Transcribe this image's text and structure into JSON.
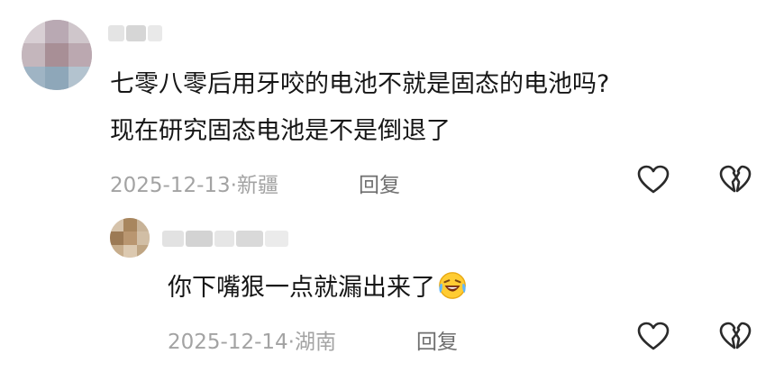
{
  "comments": [
    {
      "text_line1": "七零八零后用牙咬的电池不就是固态的电池吗?",
      "text_line2": "现在研究固态电池是不是倒退了",
      "date": "2025-12-13",
      "separator": "·",
      "location": "新疆",
      "reply_label": "回复"
    }
  ],
  "replies": [
    {
      "text": "你下嘴狠一点就漏出来了",
      "emoji_icon": "laughing-crying-face-icon",
      "date": "2025-12-14",
      "separator": "·",
      "location": "湖南",
      "reply_label": "回复"
    }
  ],
  "icons": {
    "like": "heart-outline-icon",
    "dislike": "broken-heart-icon"
  },
  "colors": {
    "text": "#161616",
    "meta": "#a3a3a3",
    "reply": "#6f6f6f",
    "icon": "#2a2a2a"
  }
}
